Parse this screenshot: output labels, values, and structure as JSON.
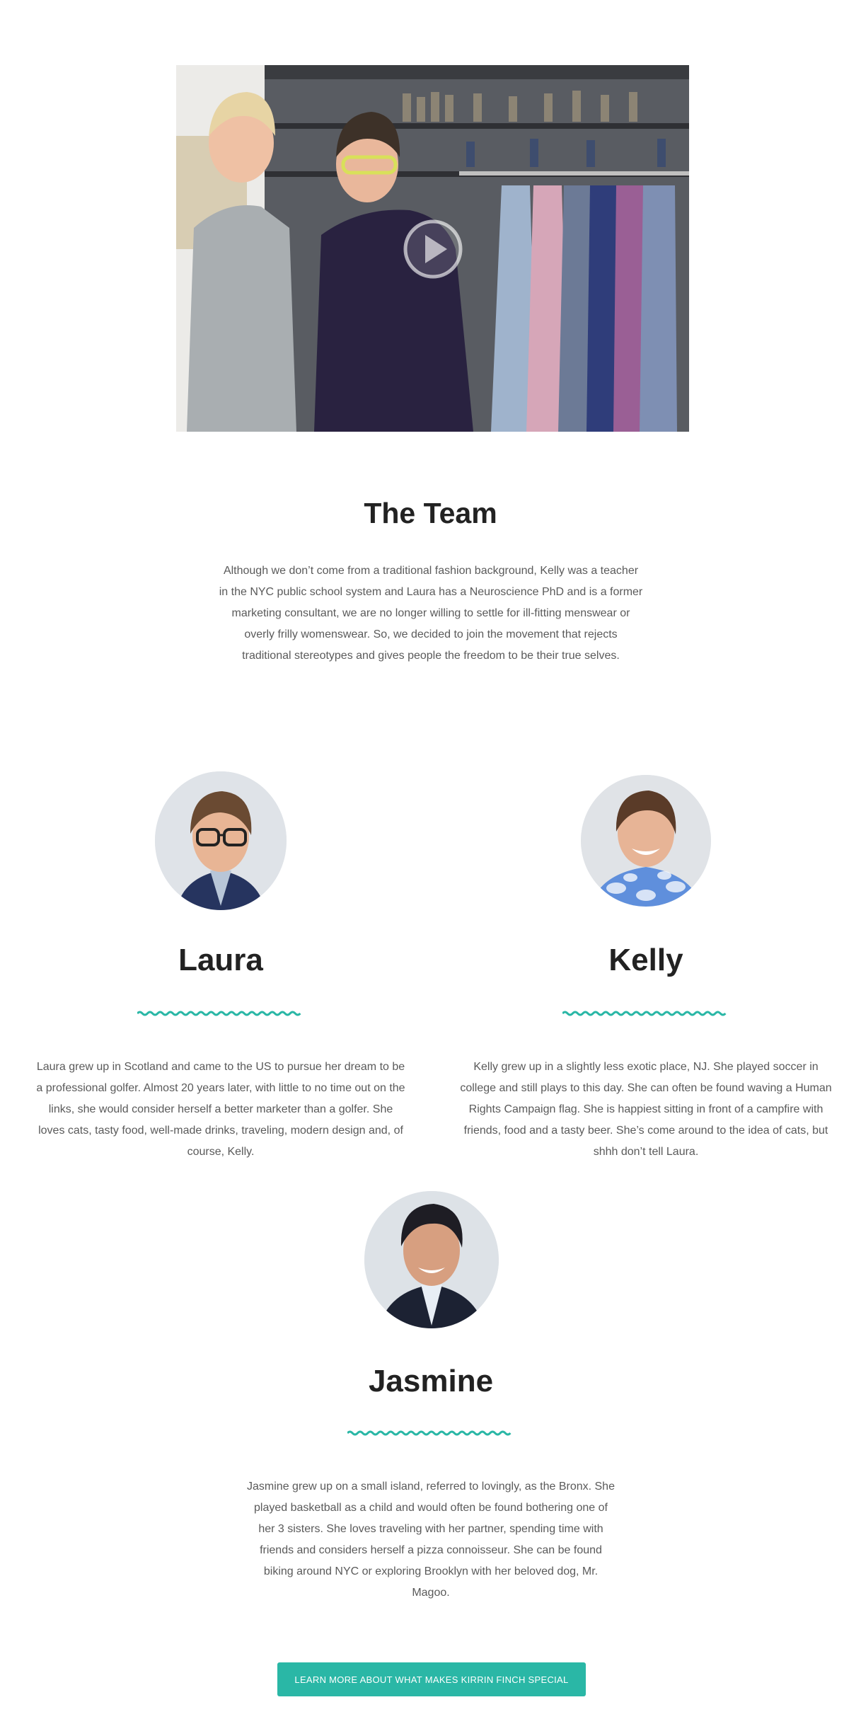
{
  "video": {
    "play_icon": "play-circle-icon"
  },
  "team": {
    "title": "The Team",
    "description": "Although we don’t come from a traditional fashion background, Kelly was a teacher in the NYC public school system and Laura has a Neuroscience PhD and is a former marketing consultant, we are no longer willing to settle for ill-fitting menswear or overly frilly womenswear. So, we decided to join the movement that rejects traditional stereotypes and gives people the freedom to be their true selves."
  },
  "members": [
    {
      "name": "Laura",
      "bio": "Laura grew up in Scotland and came to the US to pursue her dream to be a professional golfer. Almost 20 years later, with little to no time out on the links, she would consider herself a better marketer than a golfer. She loves cats, tasty food, well-made drinks, traveling, modern design and, of course, Kelly."
    },
    {
      "name": "Kelly",
      "bio": "Kelly grew up in a slightly less exotic place, NJ. She played soccer in college and still plays to this day. She can often be found waving a Human Rights Campaign flag. She is happiest sitting in front of a campfire with friends, food and a tasty beer. She’s come around to the idea of cats, but shhh don’t tell Laura."
    },
    {
      "name": "Jasmine",
      "bio": "Jasmine grew up on a small island, referred to lovingly, as the Bronx. She played basketball as a child and would often be found bothering one of her 3 sisters. She loves traveling with her partner, spending time with friends and considers herself a pizza connoisseur. She can be found biking around NYC or exploring Brooklyn with her beloved dog, Mr. Magoo."
    }
  ],
  "cta": {
    "label": "LEARN MORE ABOUT WHAT MAKES KIRRIN FINCH SPECIAL"
  },
  "colors": {
    "accent": "#2ab7a6",
    "heading": "#222222",
    "body_text": "#5a5a5a"
  }
}
